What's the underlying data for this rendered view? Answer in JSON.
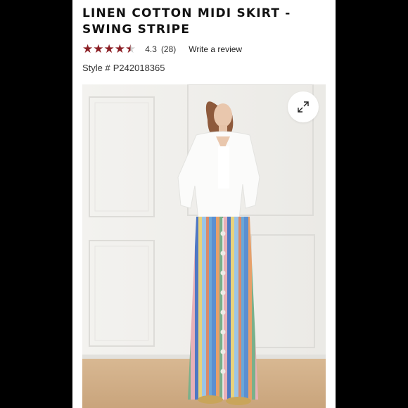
{
  "product": {
    "title": "LINEN COTTON MIDI SKIRT - SWING STRIPE",
    "rating": {
      "stars_value": 4.3,
      "value_text": "4.3",
      "count_text": "(28)",
      "write_review_label": "Write a review"
    },
    "style": {
      "label": "Style #",
      "number": "P242018365"
    }
  },
  "image": {
    "expand_icon": "expand-arrows-icon"
  },
  "colors": {
    "star": "#8b1e24",
    "star_empty": "#cfcfcf",
    "side_panels": "#000000",
    "title": "#111111"
  }
}
